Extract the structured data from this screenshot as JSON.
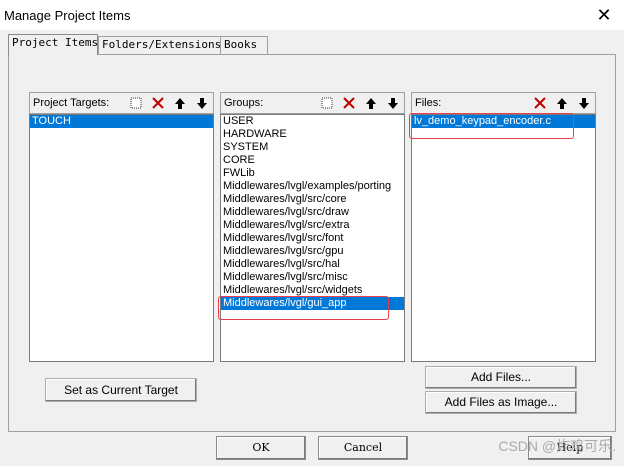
{
  "window": {
    "title": "Manage Project Items",
    "close_glyph": "✕"
  },
  "tabs": [
    {
      "label": "Project Items"
    },
    {
      "label": "Folders/Extensions"
    },
    {
      "label": "Books"
    }
  ],
  "targets": {
    "header": "Project Targets:",
    "items": [
      "TOUCH"
    ],
    "selected_index": 0
  },
  "groups": {
    "header": "Groups:",
    "items": [
      "USER",
      "HARDWARE",
      "SYSTEM",
      "CORE",
      "FWLib",
      "Middlewares/lvgl/examples/porting",
      "Middlewares/lvgl/src/core",
      "Middlewares/lvgl/src/draw",
      "Middlewares/lvgl/src/extra",
      "Middlewares/lvgl/src/font",
      "Middlewares/lvgl/src/gpu",
      "Middlewares/lvgl/src/hal",
      "Middlewares/lvgl/src/misc",
      "Middlewares/lvgl/src/widgets",
      "Middlewares/lvgl/gui_app"
    ],
    "selected_index": 14
  },
  "files": {
    "header": "Files:",
    "items": [
      "lv_demo_keypad_encoder.c"
    ],
    "selected_index": 0
  },
  "buttons": {
    "set_target": "Set as Current Target",
    "add_files": "Add Files...",
    "add_files_image": "Add Files as Image...",
    "ok": "OK",
    "cancel": "Cancel",
    "help": "Help"
  },
  "watermark": "CSDN @炸鸡可乐.",
  "colors": {
    "selection": "#0078d7",
    "highlight_box": "#e8414b",
    "delete_icon": "#c00000"
  },
  "icons": [
    "new-icon",
    "delete-icon",
    "move-up-icon",
    "move-down-icon"
  ]
}
